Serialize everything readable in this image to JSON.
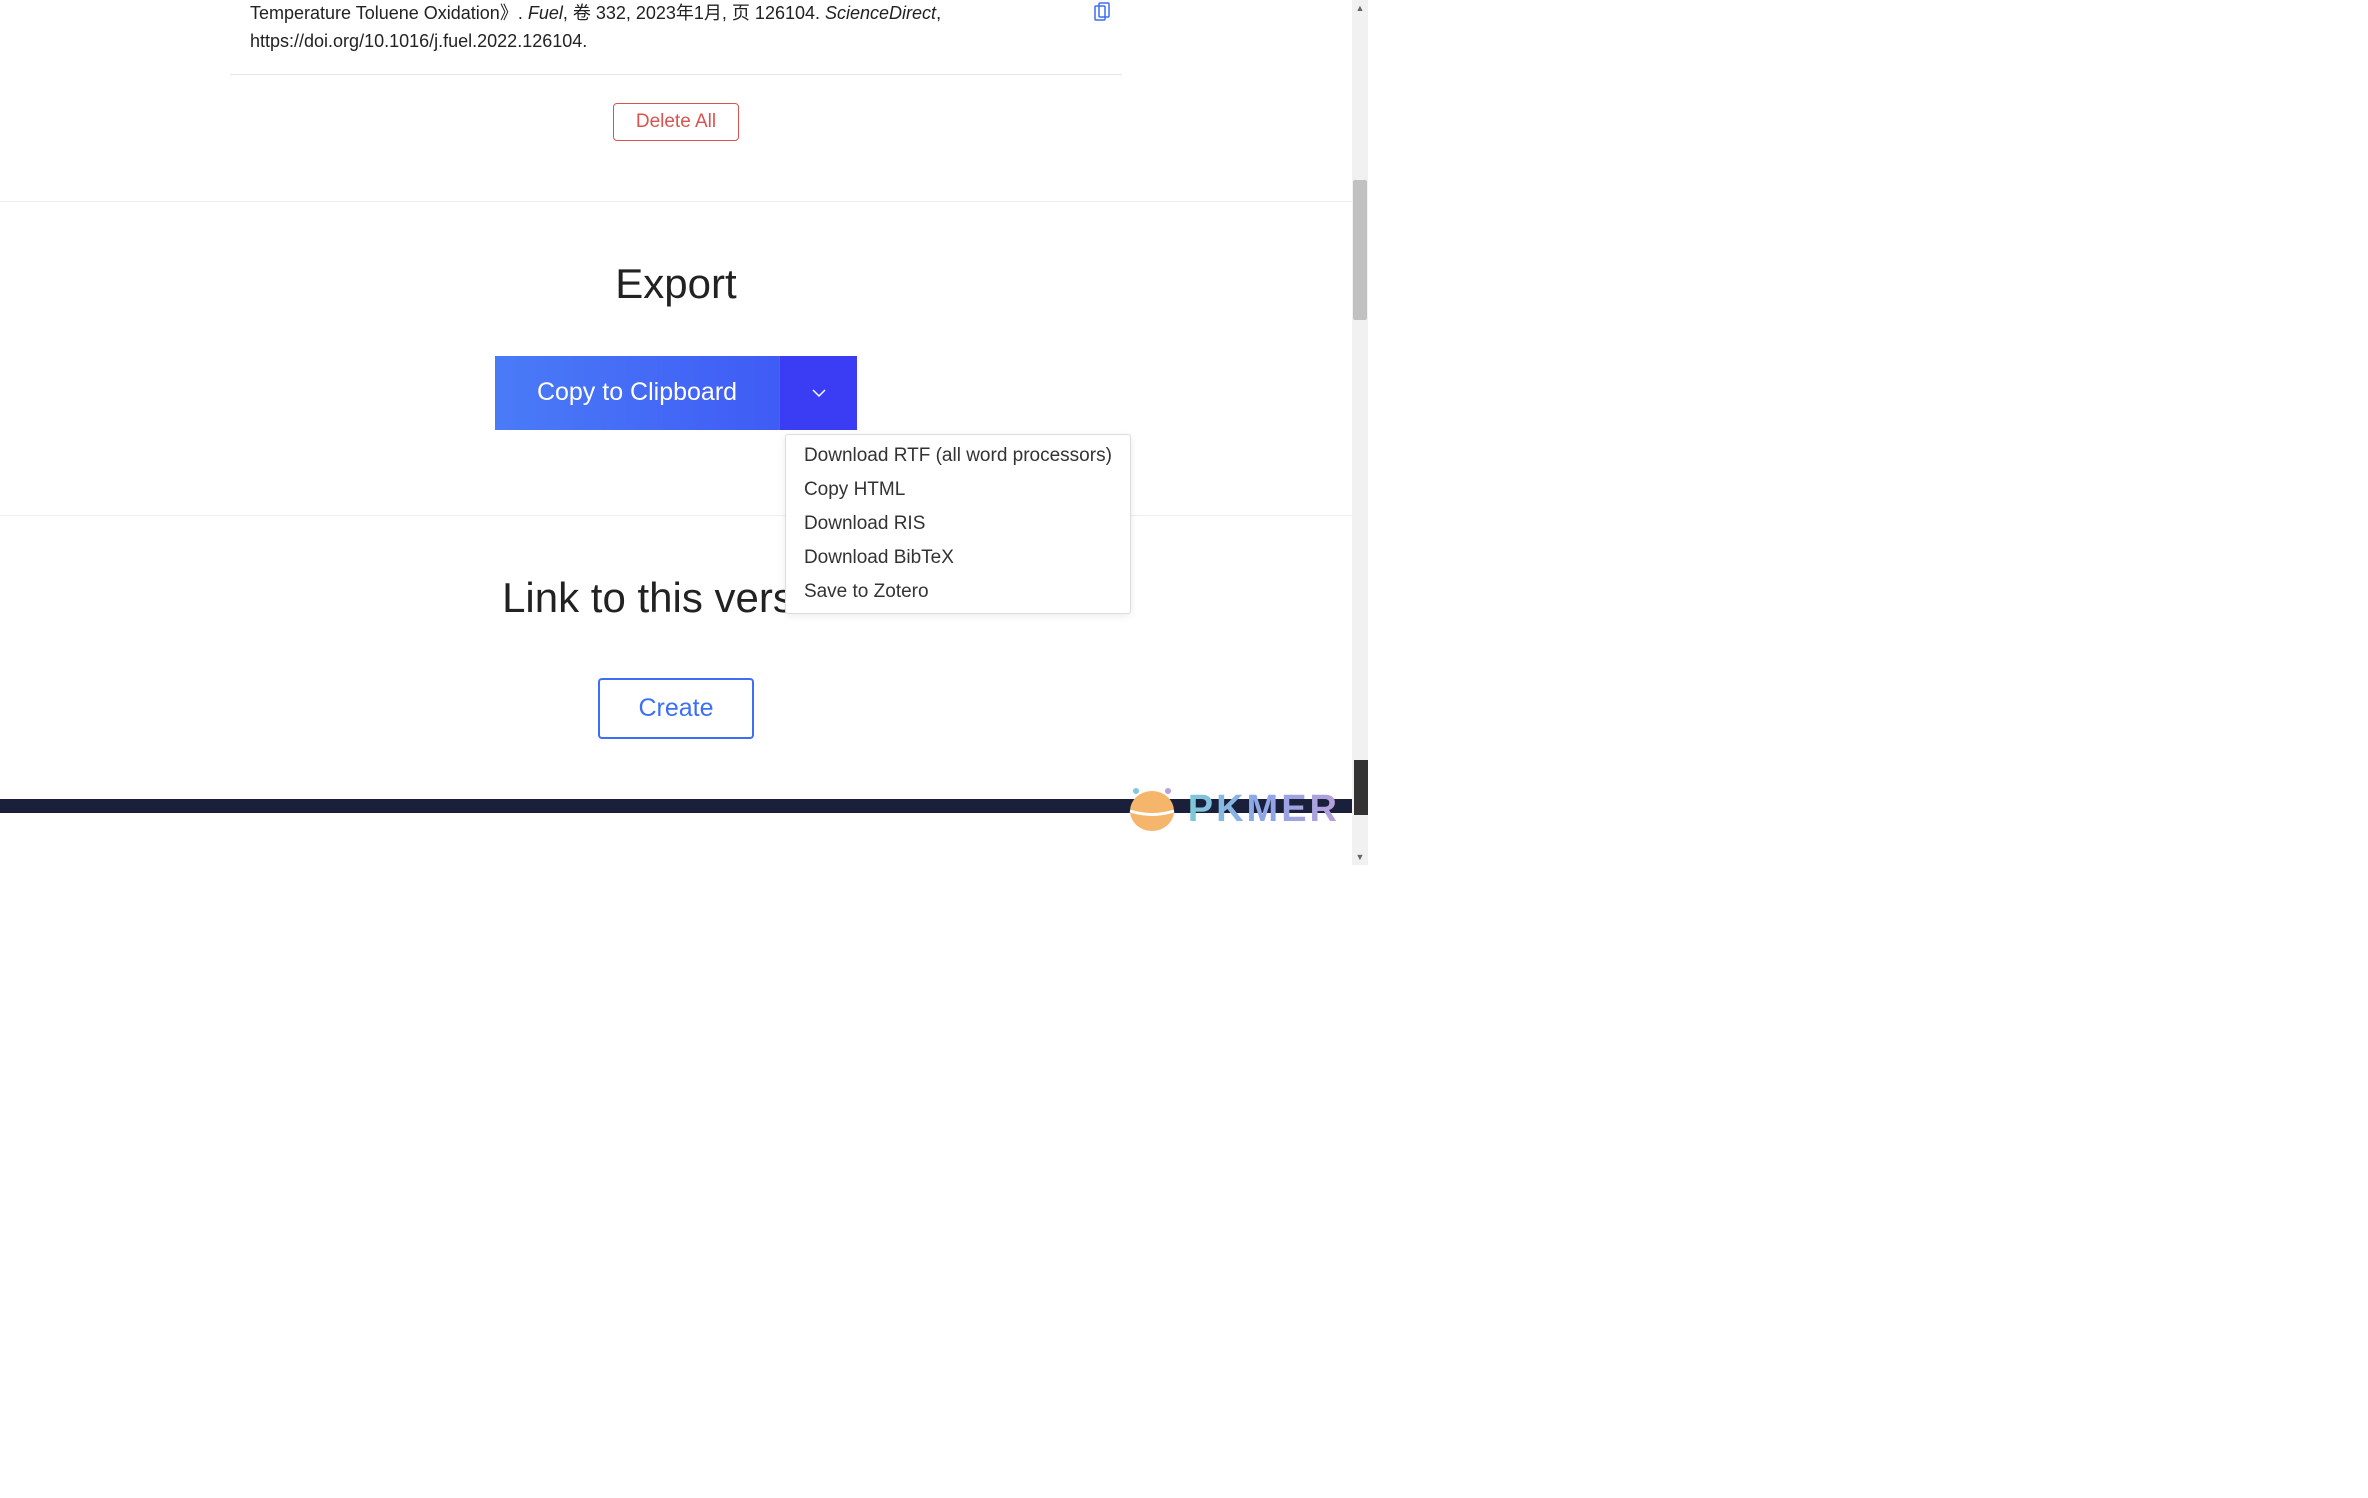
{
  "citation": {
    "title_fragment": "Temperature Toluene Oxidation》. ",
    "journal": "Fuel",
    "details_1": ", 卷 332, 2023年1月, 页 126104. ",
    "source": "ScienceDirect",
    "details_2": ", https://doi.org/10.1016/j.fuel.2022.126104."
  },
  "buttons": {
    "delete_all": "Delete All",
    "copy_clipboard": "Copy to Clipboard",
    "create": "Create"
  },
  "sections": {
    "export": "Export",
    "link_version": "Link to this version"
  },
  "dropdown": {
    "items": [
      "Download RTF (all word processors)",
      "Copy HTML",
      "Download RIS",
      "Download BibTeX",
      "Save to Zotero"
    ]
  },
  "watermark": {
    "text": "PKMER"
  }
}
